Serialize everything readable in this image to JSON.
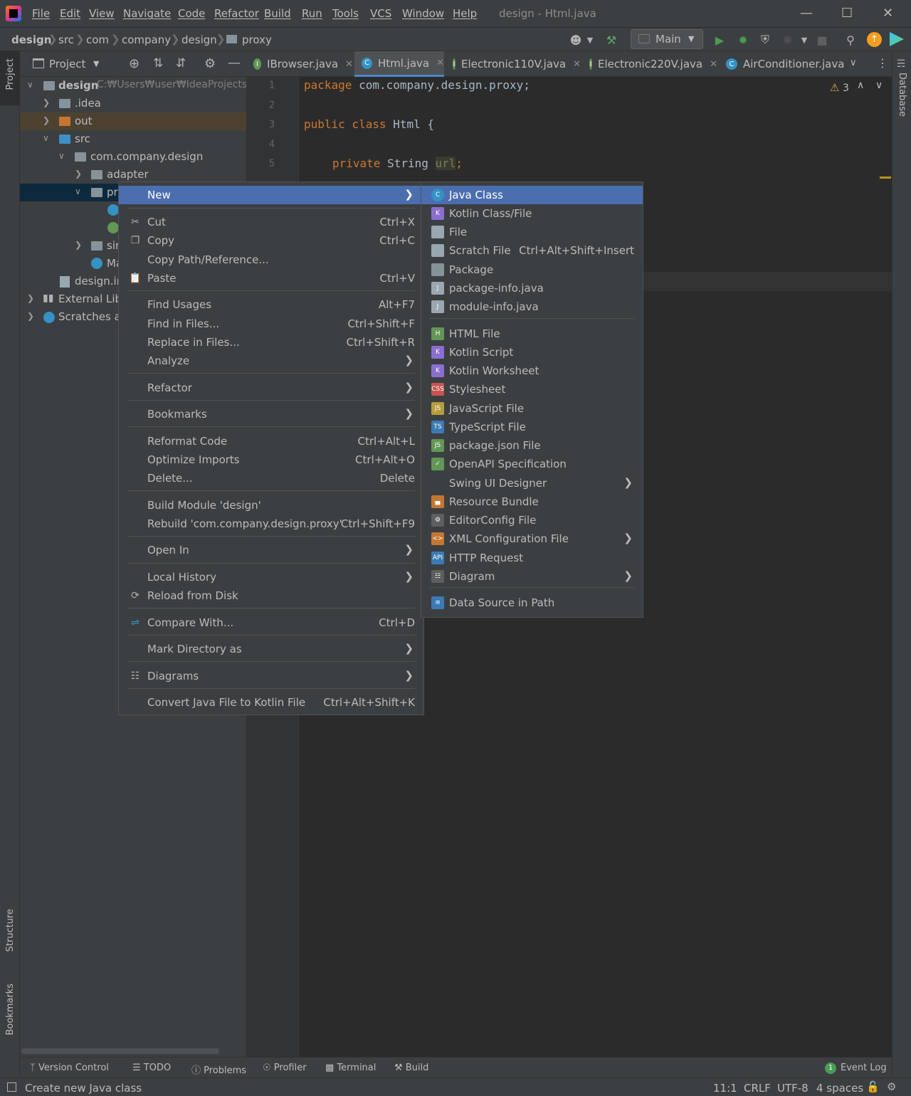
{
  "menubar": {
    "items": [
      "File",
      "Edit",
      "View",
      "Navigate",
      "Code",
      "Refactor",
      "Build",
      "Run",
      "Tools",
      "VCS",
      "Window",
      "Help"
    ],
    "window_title": "design - Html.java"
  },
  "navbar": {
    "breadcrumbs": [
      "design",
      "src",
      "com",
      "company",
      "design",
      "proxy"
    ],
    "run_config": "Main"
  },
  "project_panel": {
    "title": "Project",
    "tree": [
      {
        "label": "design",
        "extra": "C:₩Users₩user₩IdeaProjects₩d"
      },
      {
        "label": ".idea"
      },
      {
        "label": "out"
      },
      {
        "label": "src"
      },
      {
        "label": "com.company.design"
      },
      {
        "label": "adapter"
      },
      {
        "label": "pr"
      },
      {
        "label": "sir"
      },
      {
        "label": "Ma"
      },
      {
        "label": "design.im"
      },
      {
        "label": "External Libr"
      },
      {
        "label": "Scratches an"
      }
    ]
  },
  "tabs": [
    {
      "label": "IBrowser.java",
      "kind": "interface"
    },
    {
      "label": "Html.java",
      "kind": "class"
    },
    {
      "label": "Electronic110V.java",
      "kind": "interface"
    },
    {
      "label": "Electronic220V.java",
      "kind": "interface"
    },
    {
      "label": "AirConditioner.java",
      "kind": "class"
    }
  ],
  "editor": {
    "line_numbers": [
      "1",
      "2",
      "3",
      "4",
      "5"
    ],
    "lines": {
      "l1_kw": "package",
      "l1_rest": " com.company.design.proxy;",
      "l3_kw": "public class",
      "l3_rest": " Html {",
      "l5_kw": "private",
      "l5_type": " String ",
      "l5_var": "url",
      "l5_end": ";"
    },
    "warnings": "3"
  },
  "context_menu": {
    "new": "New",
    "cut": {
      "label": "Cut",
      "shortcut": "Ctrl+X"
    },
    "copy": {
      "label": "Copy",
      "shortcut": "Ctrl+C"
    },
    "copy_path": "Copy Path/Reference...",
    "paste": {
      "label": "Paste",
      "shortcut": "Ctrl+V"
    },
    "find_usages": {
      "label": "Find Usages",
      "shortcut": "Alt+F7"
    },
    "find_in_files": {
      "label": "Find in Files...",
      "shortcut": "Ctrl+Shift+F"
    },
    "replace_in_files": {
      "label": "Replace in Files...",
      "shortcut": "Ctrl+Shift+R"
    },
    "analyze": "Analyze",
    "refactor": "Refactor",
    "bookmarks": "Bookmarks",
    "reformat": {
      "label": "Reformat Code",
      "shortcut": "Ctrl+Alt+L"
    },
    "optimize": {
      "label": "Optimize Imports",
      "shortcut": "Ctrl+Alt+O"
    },
    "delete": {
      "label": "Delete...",
      "shortcut": "Delete"
    },
    "build_module": "Build Module 'design'",
    "rebuild": {
      "label": "Rebuild 'com.company.design.proxy'",
      "shortcut": "Ctrl+Shift+F9"
    },
    "open_in": "Open In",
    "local_history": "Local History",
    "reload": "Reload from Disk",
    "compare": {
      "label": "Compare With...",
      "shortcut": "Ctrl+D"
    },
    "mark_dir": "Mark Directory as",
    "diagrams": "Diagrams",
    "convert": {
      "label": "Convert Java File to Kotlin File",
      "shortcut": "Ctrl+Alt+Shift+K"
    }
  },
  "new_submenu": {
    "items": [
      {
        "label": "Java Class",
        "icon": "java-class-icon",
        "color": "#3592c4",
        "glyph": "C"
      },
      {
        "label": "Kotlin Class/File",
        "icon": "kotlin-file-icon",
        "color": "#8a6fd1",
        "glyph": "K"
      },
      {
        "label": "File",
        "icon": "file-icon",
        "color": "#9aa7b0",
        "glyph": ""
      },
      {
        "label": "Scratch File",
        "shortcut": "Ctrl+Alt+Shift+Insert",
        "icon": "scratch-file-icon",
        "color": "#9aa7b0",
        "glyph": ""
      },
      {
        "label": "Package",
        "icon": "package-icon",
        "color": "#87939a",
        "glyph": ""
      },
      {
        "label": "package-info.java",
        "icon": "java-file-icon",
        "color": "#9aa7b0",
        "glyph": "J"
      },
      {
        "label": "module-info.java",
        "icon": "java-file-icon",
        "color": "#9aa7b0",
        "glyph": "J"
      },
      {
        "label": "HTML File",
        "icon": "html-file-icon",
        "color": "#629755",
        "glyph": "H"
      },
      {
        "label": "Kotlin Script",
        "icon": "kotlin-script-icon",
        "color": "#8a6fd1",
        "glyph": "K"
      },
      {
        "label": "Kotlin Worksheet",
        "icon": "kotlin-worksheet-icon",
        "color": "#8a6fd1",
        "glyph": "K"
      },
      {
        "label": "Stylesheet",
        "icon": "css-file-icon",
        "color": "#c75450",
        "glyph": "CSS"
      },
      {
        "label": "JavaScript File",
        "icon": "js-file-icon",
        "color": "#b59c3d",
        "glyph": "JS"
      },
      {
        "label": "TypeScript File",
        "icon": "ts-file-icon",
        "color": "#3c7ab5",
        "glyph": "TS"
      },
      {
        "label": "package.json File",
        "icon": "nodejs-icon",
        "color": "#629755",
        "glyph": "JS"
      },
      {
        "label": "OpenAPI Specification",
        "icon": "openapi-icon",
        "color": "#629755",
        "glyph": "✓"
      },
      {
        "label": "Swing UI Designer",
        "icon": "",
        "color": "",
        "glyph": "",
        "submenu": true
      },
      {
        "label": "Resource Bundle",
        "icon": "resource-bundle-icon",
        "color": "#c57633",
        "glyph": "▄"
      },
      {
        "label": "EditorConfig File",
        "icon": "gear-icon",
        "color": "#5e6060",
        "glyph": "⚙"
      },
      {
        "label": "XML Configuration File",
        "icon": "xml-file-icon",
        "color": "#c57633",
        "glyph": "<>",
        "submenu": true
      },
      {
        "label": "HTTP Request",
        "icon": "api-icon",
        "color": "#3c7ab5",
        "glyph": "API"
      },
      {
        "label": "Diagram",
        "icon": "diagram-icon",
        "color": "#5e6060",
        "glyph": "☷",
        "submenu": true
      },
      {
        "label": "Data Source in Path",
        "icon": "database-icon",
        "color": "#3c7ab5",
        "glyph": "≡"
      }
    ]
  },
  "bottom_tools": [
    "Version Control",
    "TODO",
    "Problems",
    "Profiler",
    "Terminal",
    "Build"
  ],
  "event_log": {
    "label": "Event Log",
    "count": "1"
  },
  "side_tools": {
    "project": "Project",
    "structure": "Structure",
    "bookmarks": "Bookmarks",
    "database": "Database"
  },
  "status": {
    "message": "Create new Java class",
    "position": "11:1",
    "line_sep": "CRLF",
    "encoding": "UTF-8",
    "indent": "4 spaces"
  }
}
